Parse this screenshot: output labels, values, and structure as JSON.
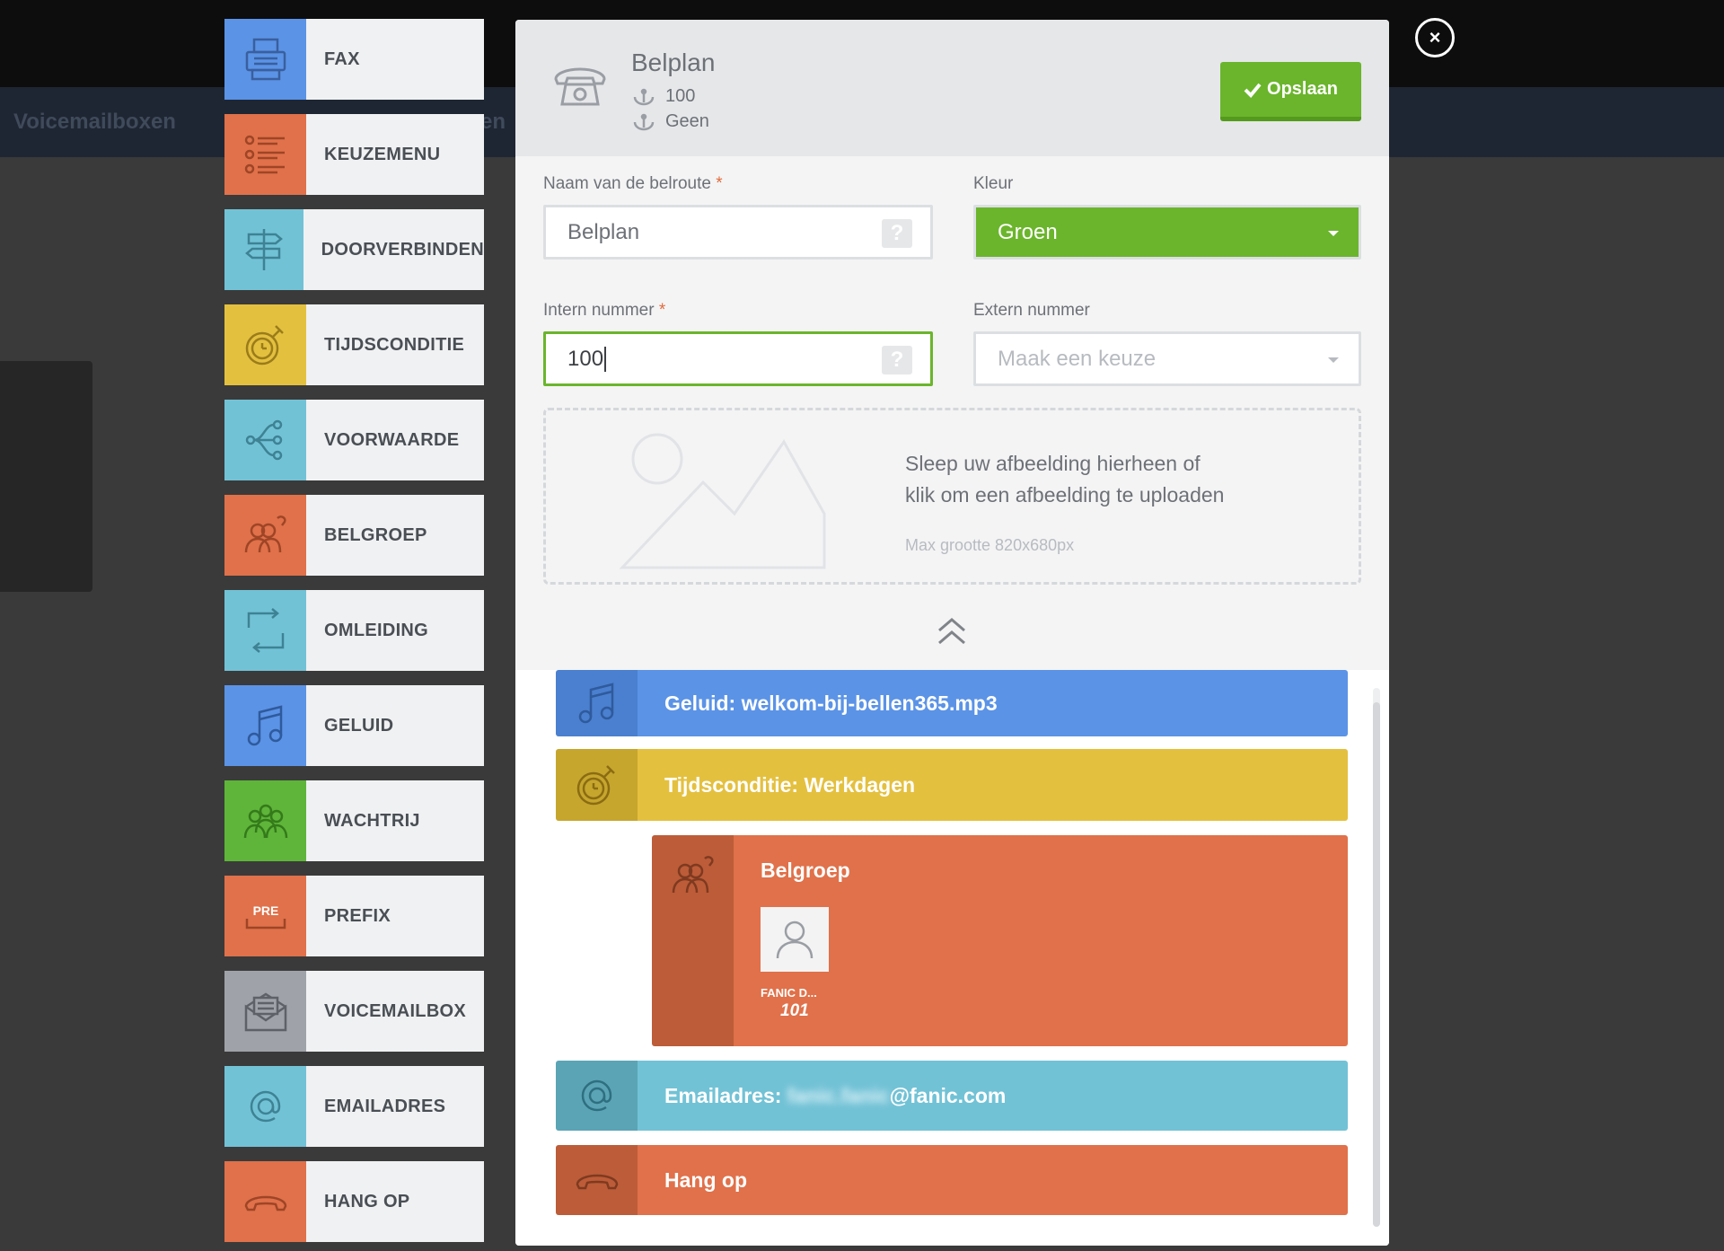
{
  "background": {
    "nav_label": "Voicemailboxen",
    "nav_label_partial": "en"
  },
  "tools": [
    {
      "label": "FAX",
      "icon": "fax-icon",
      "color": "#5b93e6"
    },
    {
      "label": "KEUZEMENU",
      "icon": "list-menu-icon",
      "color": "#e0714a"
    },
    {
      "label": "DOORVERBINDEN",
      "icon": "signpost-icon",
      "color": "#72c2d6"
    },
    {
      "label": "TIJDSCONDITIE",
      "icon": "stopwatch-icon",
      "color": "#e4c03f"
    },
    {
      "label": "VOORWAARDE",
      "icon": "branch-icon",
      "color": "#72c2d6"
    },
    {
      "label": "BELGROEP",
      "icon": "group-call-icon",
      "color": "#e0714a"
    },
    {
      "label": "OMLEIDING",
      "icon": "redirect-icon",
      "color": "#72c2d6"
    },
    {
      "label": "GELUID",
      "icon": "music-note-icon",
      "color": "#5b93e6"
    },
    {
      "label": "WACHTRIJ",
      "icon": "queue-icon",
      "color": "#5fb53a"
    },
    {
      "label": "PREFIX",
      "icon": "prefix-icon",
      "color": "#e0714a"
    },
    {
      "label": "VOICEMAILBOX",
      "icon": "envelope-icon",
      "color": "#9fa3a9"
    },
    {
      "label": "EMAILADRES",
      "icon": "at-sign-icon",
      "color": "#72c2d6"
    },
    {
      "label": "HANG OP",
      "icon": "hang-up-icon",
      "color": "#e0714a"
    }
  ],
  "modal": {
    "title": "Belplan",
    "meta_intern": "100",
    "meta_extern": "Geen",
    "save_label": "Opslaan",
    "close_symbol": "×",
    "form": {
      "name_label": "Naam van de belroute",
      "name_value": "Belplan",
      "color_label": "Kleur",
      "color_value": "Groen",
      "intern_label": "Intern nummer",
      "intern_value": "100",
      "extern_label": "Extern nummer",
      "extern_placeholder": "Maak een keuze",
      "required_mark": "*",
      "help_symbol": "?"
    },
    "dropzone": {
      "line1": "Sleep uw afbeelding hierheen of",
      "line2": "klik om een afbeelding te uploaden",
      "max_size": "Max grootte 820x680px"
    },
    "flow": {
      "geluid": "Geluid: welkom-bij-bellen365.mp3",
      "tijdsconditie": "Tijdsconditie: Werkdagen",
      "belgroep": "Belgroep",
      "member_name": "FANIC D...",
      "member_ext": "101",
      "email_prefix": "Emailadres: ",
      "email_redacted": "fanic.fanic",
      "email_domain": "@fanic.com",
      "hangup": "Hang op"
    }
  },
  "colors": {
    "accent_green": "#6bb52c",
    "blue": "#5b93e6",
    "orange": "#e0714a",
    "yellow": "#e4c03f",
    "cyan": "#72c2d6",
    "gray": "#9fa3a9"
  }
}
